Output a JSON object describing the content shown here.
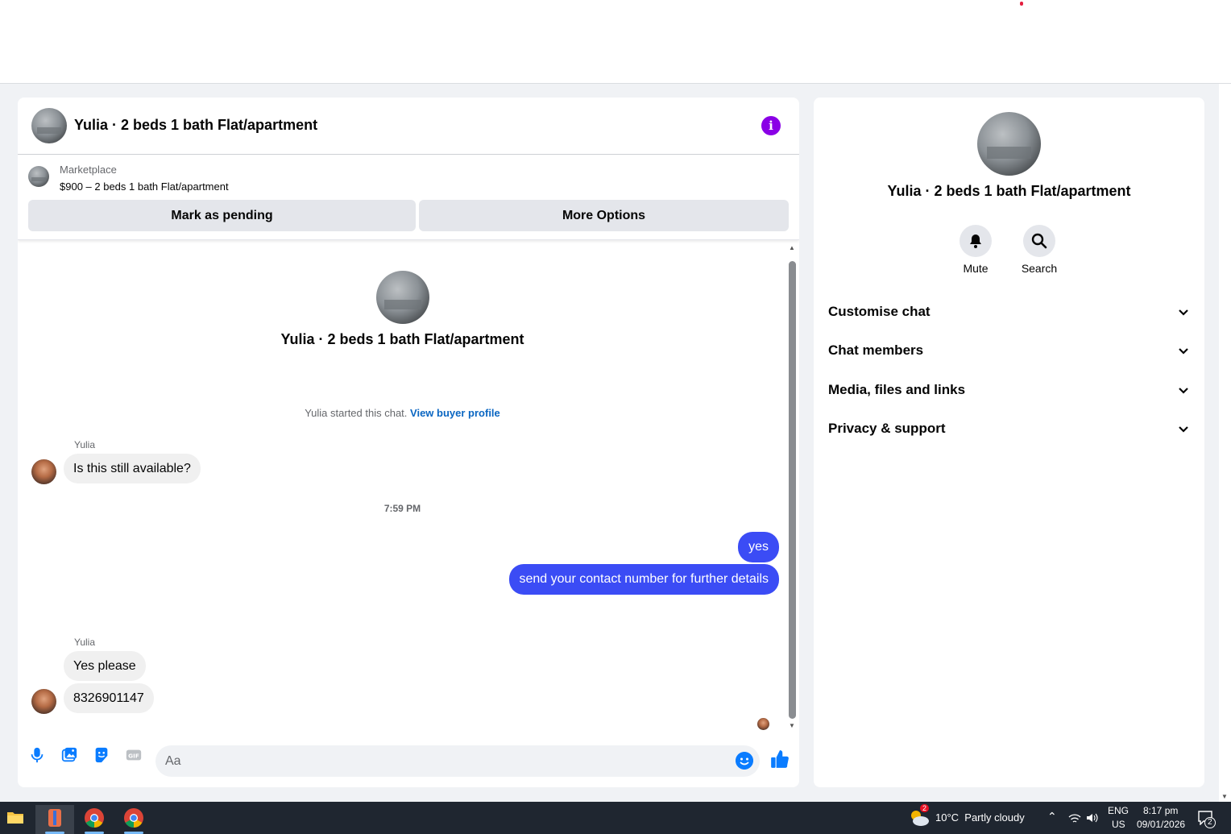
{
  "chat": {
    "title": "Yulia · 2 beds 1 bath Flat/apartment",
    "info_icon": "info-icon",
    "listing": {
      "label": "Marketplace",
      "description": "$900 – 2 beds 1 bath Flat/apartment",
      "mark_pending_label": "Mark as pending",
      "more_options_label": "More Options"
    },
    "center_title": "Yulia · 2 beds 1 bath Flat/apartment",
    "started_text": "Yulia started this chat.",
    "view_buyer_link": "View buyer profile",
    "messages": [
      {
        "sender": "Yulia",
        "text": "Is this still available?"
      },
      {
        "timestamp": "7:59 PM"
      },
      {
        "sender": "me",
        "text": "yes"
      },
      {
        "sender": "me",
        "text": "send your contact number for further details"
      },
      {
        "sender": "Yulia",
        "text": "Yes please"
      },
      {
        "sender": "Yulia",
        "text": "8326901147"
      }
    ],
    "composer": {
      "placeholder": "Aa",
      "icons": [
        "microphone-icon",
        "photo-icon",
        "sticker-icon",
        "gif-icon",
        "emoji-icon",
        "like-icon"
      ]
    }
  },
  "details": {
    "title": "Yulia · 2 beds 1 bath Flat/apartment",
    "mute_label": "Mute",
    "search_label": "Search",
    "sections": [
      "Customise chat",
      "Chat members",
      "Media, files and links",
      "Privacy & support"
    ]
  },
  "taskbar": {
    "weather": "10°C  Partly cloudy",
    "weather_badge": "2",
    "lang_top": "ENG",
    "lang_bottom": "US",
    "time": "8:17 pm",
    "date": "09/01/2026",
    "notification_count": "2"
  },
  "colors": {
    "accent": "#3b4cf5",
    "info": "#8a00e6",
    "link": "#0a66c2",
    "composer_icon": "#0a7cff"
  }
}
